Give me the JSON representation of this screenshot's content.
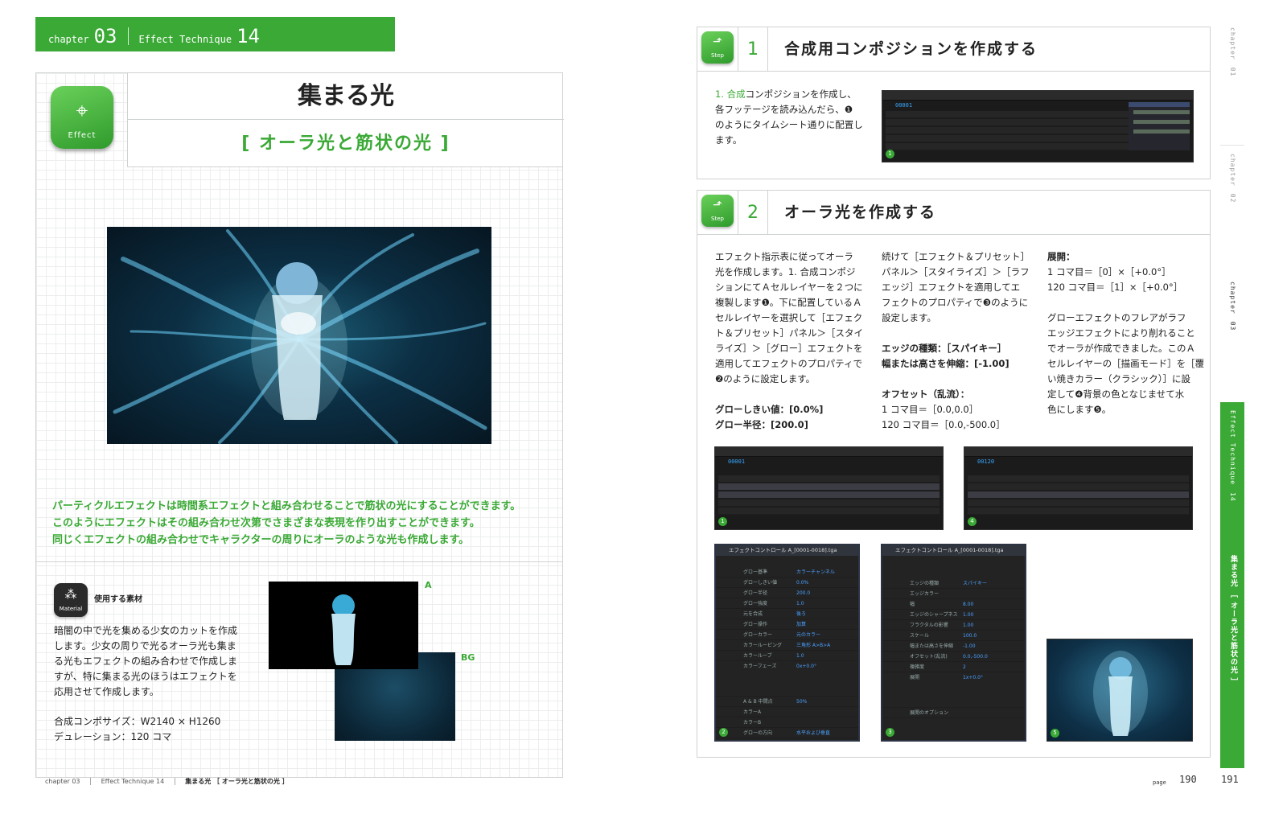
{
  "header": {
    "chapter_label": "chapter",
    "chapter_num": "03",
    "technique_label": "Effect Technique",
    "technique_num": "14"
  },
  "title_block": {
    "icon_label": "Effect",
    "title": "集まる光",
    "subtitle": "[ オーラ光と筋状の光 ]"
  },
  "intro": [
    "パーティクルエフェクトは時間系エフェクトと組み合わせることで筋状の光にすることができます。",
    "このようにエフェクトはその組み合わせ次第でさまざまな表現を作り出すことができます。",
    "同じくエフェクトの組み合わせでキャラクターの周りにオーラのような光も作成します。"
  ],
  "material": {
    "icon_label": "Material",
    "heading": "使用する素材",
    "text": [
      "暗闇の中で光を集める少女のカットを作成",
      "します。少女の周りで光るオーラ光も集ま",
      "る光もエフェクトの組み合わせで作成しま",
      "すが、特に集まる光のほうはエフェクトを",
      "応用させて作成します。"
    ],
    "comp_size": "合成コンポサイズ：W2140 × H1260",
    "duration": "デュレーション：120 コマ",
    "label_a": "A",
    "label_bg": "BG"
  },
  "step1": {
    "icon_label": "Step",
    "num": "1",
    "title": "合成用コンポジションを作成する",
    "text_g": "1. 合成",
    "text": [
      "コンポジションを作成し、",
      "各フッテージを読み込んだら、❶",
      "のようにタイムシート通りに配置し",
      "ます。"
    ],
    "shot_code": "00001",
    "badge": "1"
  },
  "step2": {
    "icon_label": "Step",
    "num": "2",
    "title": "オーラ光を作成する",
    "col1": [
      "エフェクト指示表に従ってオーラ",
      "光を作成します。1. 合成コンポジ",
      "ションにてＡセルレイヤーを２つに",
      "複製します❶。下に配置しているＡ",
      "セルレイヤーを選択して［エフェク",
      "ト＆プリセット］パネル＞［スタイ",
      "ライズ］＞［グロー］エフェクトを",
      "適用してエフェクトのプロパティで",
      "❷のように設定します。"
    ],
    "glow_threshold": "グローしきい値：[0.0%]",
    "glow_radius": "グロー半径：[200.0]",
    "col2": [
      "続けて［エフェクト＆プリセット］",
      "パネル＞［スタイライズ］＞［ラフ",
      "エッジ］エフェクトを適用してエ",
      "フェクトのプロパティで❸のように",
      "設定します。"
    ],
    "edge_type": "エッジの種類：［スパイキー］",
    "edge_scale": "幅または高さを伸縮：[-1.00]",
    "offset_head": "オフセット（乱流）：",
    "offset_1": "1 コマ目＝［0.0,0.0］",
    "offset_120": "120 コマ目＝［0.0,-500.0］",
    "col3_head": "展開：",
    "expand_1": "1 コマ目＝［0］×［+0.0°］",
    "expand_120": "120 コマ目＝［1］×［+0.0°］",
    "col3": [
      "グローエフェクトのフレアがラフ",
      "エッジエフェクトにより削れること",
      "でオーラが作成できました。このＡ",
      "セルレイヤーの［描画モード］を［覆",
      "い焼きカラー（クラシック）］に設",
      "定して❹背景の色となじませて水",
      "色にします❺。"
    ],
    "shot1_code": "00001",
    "shot4_code": "00120",
    "panel2_title": "エフェクトコントロール A_[0001-0018].tga",
    "panel2_rows": [
      "グロー基準",
      "グローしきい値",
      "グロー半径",
      "グロー強度",
      "元を合成",
      "グロー操作",
      "グローカラー",
      "カラールーピング",
      "カラールーブ",
      "カラーフェーズ",
      "A & B 中間点",
      "カラーA",
      "カラーB",
      "グローの方向"
    ],
    "panel2_values": [
      "カラーチャンネル",
      "0.0%",
      "200.0",
      "1.0",
      "後ろ",
      "加算",
      "元のカラー",
      "三角形 A>B>A",
      "1.0",
      "0x+0.0°",
      "50%",
      "",
      "",
      "水平および垂直"
    ],
    "panel3_title": "エフェクトコントロール A_[0001-0018].tga",
    "panel3_rows": [
      "エッジの種類",
      "エッジカラー",
      "幅",
      "エッジのシャープネス",
      "フラクタルの影響",
      "スケール",
      "幅または高さを伸縮",
      "オフセット(乱流)",
      "複雑度",
      "展開",
      "展開のオプション"
    ],
    "panel3_values": [
      "スパイキー",
      "",
      "8.00",
      "1.00",
      "1.00",
      "100.0",
      "-1.00",
      "0.0,-500.0",
      "2",
      "1x+0.0°",
      ""
    ],
    "badges": [
      "1",
      "2",
      "3",
      "4",
      "5"
    ]
  },
  "side_tabs": [
    {
      "label": "chapter",
      "num": "01"
    },
    {
      "label": "chapter",
      "num": "02"
    },
    {
      "label": "chapter",
      "num": "03"
    }
  ],
  "green_tab": {
    "label": "Effect Technique",
    "num": "14",
    "title": "集まる光 ［ オーラ光と筋状の光 ］"
  },
  "footer": {
    "chapter": "chapter 03",
    "technique": "Effect Technique 14",
    "title": "集まる光 ［ オーラ光と筋状の光 ］",
    "page_label": "page",
    "page_left": "190",
    "page_right": "191"
  },
  "colors": {
    "accent": "#3aa935",
    "dark_ui": "#1b1b1b",
    "timecode": "#38a8ff"
  }
}
